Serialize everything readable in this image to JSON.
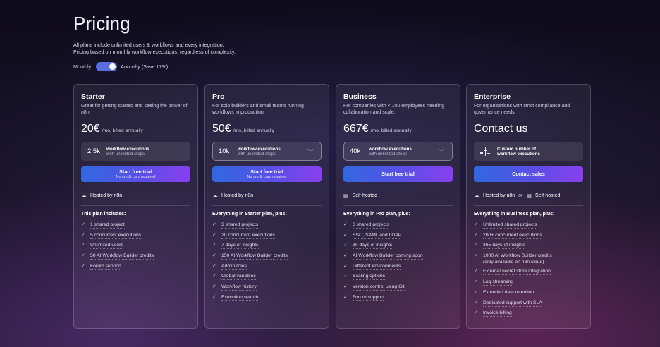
{
  "page": {
    "title": "Pricing",
    "intro_line1": "All plans include unlimited users & workflows and every integration.",
    "intro_line2": "Pricing based on monthly workflow executions, regardless of complexity.",
    "toggle": {
      "left_label": "Monthly",
      "right_label": "Annually (Save 17%)",
      "selected": "Annually"
    }
  },
  "plans": [
    {
      "name": "Starter",
      "desc": "Great for getting started and seeing the power of n8n.",
      "price": "20€",
      "per": "/mo, billed annually",
      "exec_value": "2.5k",
      "exec_label": "workflow executions",
      "exec_sub": "with unlimited steps",
      "cta": "Start free trial",
      "cta_sub": "No credit card required",
      "hosted": "Hosted by n8n",
      "includes": "This plan includes:",
      "features": [
        "1 shared project",
        "5 concurrent executions",
        "Unlimited users",
        "50 AI Workflow Builder credits",
        "Forum support"
      ]
    },
    {
      "name": "Pro",
      "desc": "For solo builders and small teams running workflows in production.",
      "price": "50€",
      "per": "/mo, billed annually",
      "exec_value": "10k",
      "exec_label": "workflow executions",
      "exec_sub": "with unlimited steps",
      "cta": "Start free trial",
      "cta_sub": "No credit card required",
      "hosted": "Hosted by n8n",
      "includes": "Everything in Starter plan, plus:",
      "features": [
        "3 shared projects",
        "20 concurrent executions",
        "7 days of insights",
        "150 AI Workflow Builder credits",
        "Admin roles",
        "Global variables",
        "Workflow history",
        "Execution search"
      ]
    },
    {
      "name": "Business",
      "desc": "For companies with < 100 employees needing collaboration and scale.",
      "price": "667€",
      "per": "/mo, billed annually",
      "exec_value": "40k",
      "exec_label": "workflow executions",
      "exec_sub": "with unlimited steps",
      "cta": "Start free trial",
      "hosted": "Self-hosted",
      "includes": "Everything in Pro plan, plus:",
      "features": [
        "6 shared projects",
        "SSO, SAML and LDAP",
        "30 days of insights",
        "AI Workflow Builder coming soon",
        "Different environments",
        "Scaling options",
        "Version control using Git",
        "Forum support"
      ]
    },
    {
      "name": "Enterprise",
      "desc": "For organisations with strict compliance and governance needs.",
      "price_text": "Contact us",
      "exec_label": "Custom number of",
      "exec_label2": "workflow executions",
      "cta": "Contact sales",
      "hosted": "Hosted by n8n",
      "hosted_or": "or",
      "hosted_alt": "Self-hosted",
      "includes": "Everything in Business plan, plus:",
      "features": [
        "Unlimited shared projects",
        "200+ concurrent executions",
        "365 days of insights",
        "1000 AI Workflow Builder credits",
        "(only available on n8n cloud)",
        "External secret store integration",
        "Log streaming",
        "Extended data retention",
        "Dedicated support with SLA",
        "Invoice billing"
      ]
    }
  ],
  "icons": {
    "cloud": "cloud-icon",
    "server": "server-icon",
    "check": "check-icon",
    "chevron": "chevron-down-icon",
    "sliders": "sliders-icon"
  },
  "colors": {
    "accent_start": "#3168e0",
    "accent_end": "#8a3ff0",
    "toggle": "#5b6ee1"
  }
}
